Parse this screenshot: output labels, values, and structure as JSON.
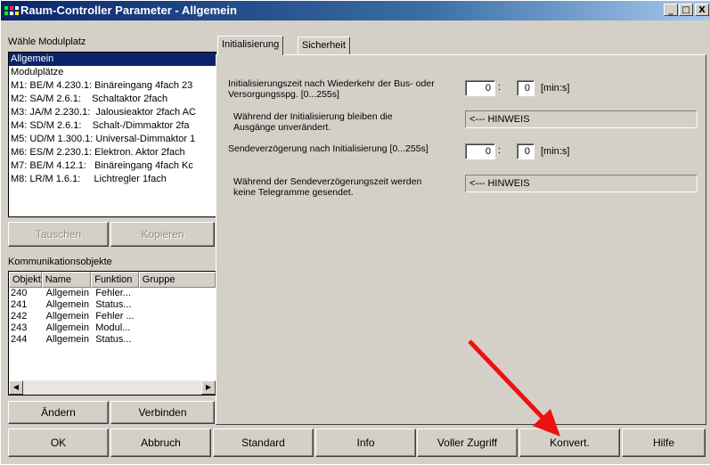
{
  "window": {
    "title": "Raum-Controller Parameter - Allgemein",
    "min_glyph": "_",
    "max_glyph": "□",
    "close_glyph": "X"
  },
  "modul": {
    "label": "Wähle Modulplatz",
    "items": [
      {
        "text": "Allgemein",
        "selected": true
      },
      {
        "text": "Modulplätze",
        "selected": false
      },
      {
        "text": "M1: BE/M 4.230.1: Binäreingang 4fach 23",
        "selected": false
      },
      {
        "text": "M2: SA/M 2.6.1:    Schaltaktor 2fach",
        "selected": false
      },
      {
        "text": "M3: JA/M 2.230.1:  Jalousieaktor 2fach AC",
        "selected": false
      },
      {
        "text": "M4: SD/M 2.6.1:    Schalt-/Dimmaktor 2fa",
        "selected": false
      },
      {
        "text": "M5: UD/M 1.300.1: Universal-Dimmaktor 1",
        "selected": false
      },
      {
        "text": "M6: ES/M 2.230.1: Elektron. Aktor 2fach",
        "selected": false
      },
      {
        "text": "M7: BE/M 4.12.1:   Binäreingang 4fach Kc",
        "selected": false
      },
      {
        "text": "M8: LR/M 1.6.1:     Lichtregler 1fach",
        "selected": false
      }
    ],
    "tauschen": "Tauschen",
    "kopieren": "Kopieren"
  },
  "komm": {
    "label": "Kommunikationsobjekte",
    "columns": [
      "Objekt",
      "Name",
      "Funktion",
      "Gruppe"
    ],
    "rows": [
      [
        "240",
        "Allgemein",
        "Fehler...",
        ""
      ],
      [
        "241",
        "Allgemein",
        "Status...",
        ""
      ],
      [
        "242",
        "Allgemein",
        "Fehler ...",
        ""
      ],
      [
        "243",
        "Allgemein",
        "Modul...",
        ""
      ],
      [
        "244",
        "Allgemein",
        "Status...",
        ""
      ]
    ],
    "aendern": "Ändern",
    "verbinden": "Verbinden",
    "left_arrow": "◀",
    "right_arrow": "▶"
  },
  "tabs": [
    "Initialisierung",
    "Sicherheit"
  ],
  "params": {
    "init_zeit_label": "Initialisierungszeit nach Wiederkehr der Bus- oder Versorgungsspg. [0...255s]",
    "init_min": "0",
    "init_sec": "0",
    "colon": ":",
    "unit": "[min:s]",
    "init_note": "Während der Initialisierung bleiben die Ausgänge unverändert.",
    "hinweis": "<--- HINWEIS",
    "send_label": "Sendeverzögerung nach Initialisierung [0...255s]",
    "send_min": "0",
    "send_sec": "0",
    "send_note": "Während der Sendeverzögerungszeit werden keine Telegramme gesendet."
  },
  "buttons": {
    "ok": "OK",
    "abbruch": "Abbruch",
    "standard": "Standard",
    "info": "Info",
    "voller": "Voller Zugriff",
    "konvert": "Konvert.",
    "hilfe": "Hilfe"
  },
  "colors": {
    "annotation_arrow": "#ee1111",
    "selection": "#0a246a"
  }
}
